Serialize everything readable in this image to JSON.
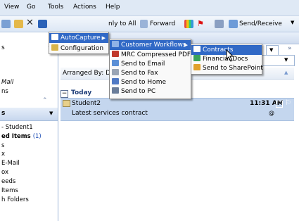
{
  "menubar": {
    "items": [
      "View",
      "Go",
      "Tools",
      "Actions",
      "Help"
    ]
  },
  "toolbar": {
    "reply_all": "nly to All",
    "forward": "Forward",
    "send_receive": "Send/Receive"
  },
  "nav": {
    "header1": "s",
    "mail_label": "Mail",
    "ns_label": "ns",
    "header2": "s",
    "items": [
      "- Student1",
      "ed Items",
      "(1)",
      "s",
      "x",
      "E-Mail",
      "ox",
      "eeds",
      "Items",
      "h Folders"
    ]
  },
  "main": {
    "arranged_by": "Arranged By: Da",
    "group_today": "Today",
    "mail": {
      "sender": "Student2",
      "subject": "Latest services contract",
      "time": "11:31 AM"
    }
  },
  "tools_menu": {
    "items": [
      "AutoCapture",
      "Configuration"
    ]
  },
  "autocapture_menu": {
    "items": [
      "Customer Workflows",
      "MRC Compressed PDF",
      "Send to Email",
      "Send to Fax",
      "Send to Home",
      "Send to PC"
    ]
  },
  "workflows_menu": {
    "items": [
      "Contracts",
      "Financial Docs",
      "Send to SharePoint"
    ]
  },
  "colors": {
    "highlight": "#3169c6",
    "selected_row": "#c4d6ee",
    "chrome": "#dfe9f5"
  }
}
